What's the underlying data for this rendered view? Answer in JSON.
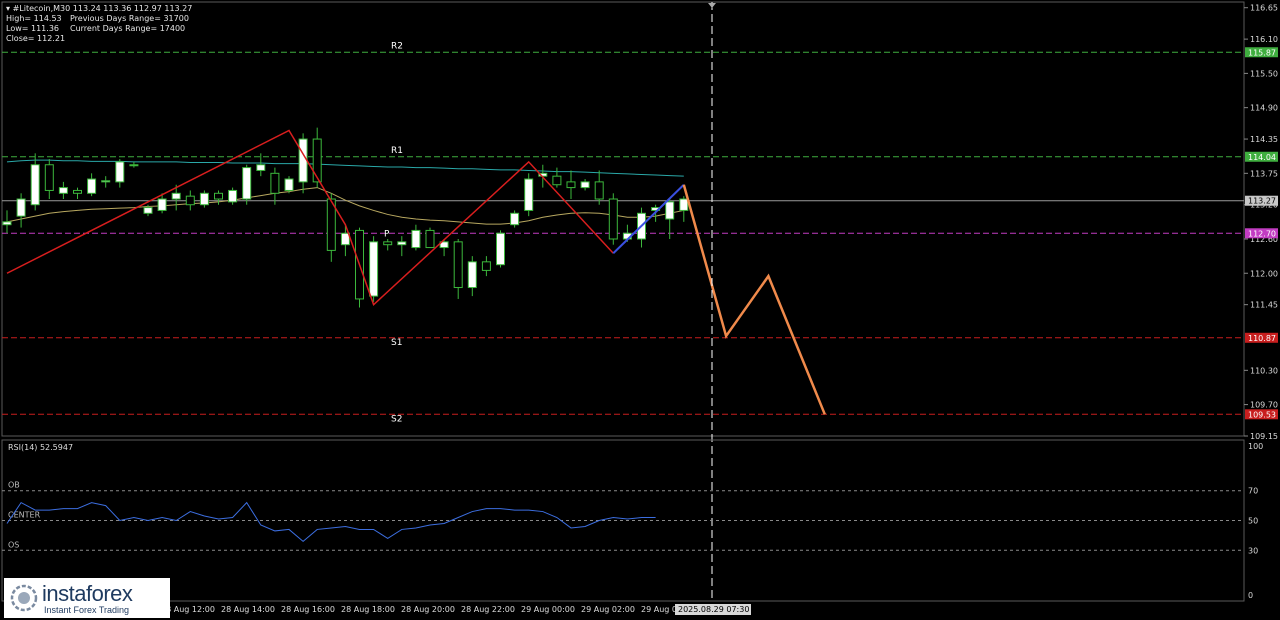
{
  "header": {
    "symbol_line": "#Litecoin,M30  113.24 113.36 112.97 113.27",
    "high": "High= 114.53",
    "prev_range": "Previous Days Range= 31700",
    "low": "Low= 111.36",
    "curr_range": "Current Days Range= 17400",
    "close": "Close= 112.21"
  },
  "chart_data": {
    "type": "candlestick",
    "price_axis": [
      "116.65",
      "116.10",
      "115.50",
      "114.90",
      "114.35",
      "113.75",
      "113.20",
      "112.60",
      "112.00",
      "111.45",
      "110.30",
      "109.70",
      "109.15"
    ],
    "price_range": [
      109.15,
      116.75
    ],
    "levels": [
      {
        "name": "R2",
        "price": 115.87,
        "label": "115.87",
        "color": "#3fae3f"
      },
      {
        "name": "R1",
        "price": 114.04,
        "label": "114.04",
        "color": "#3fae3f"
      },
      {
        "name": "P",
        "price": 112.7,
        "label": "112.70",
        "color": "#c23cc2"
      },
      {
        "name": "S1",
        "price": 110.87,
        "label": "110.87",
        "color": "#c81e1e"
      },
      {
        "name": "S2",
        "price": 109.53,
        "label": "109.53",
        "color": "#c81e1e"
      }
    ],
    "current_price": {
      "price": 113.27,
      "label": "113.27"
    },
    "candles": [
      {
        "o": 112.85,
        "h": 113.1,
        "l": 112.7,
        "c": 112.9
      },
      {
        "o": 113.0,
        "h": 113.4,
        "l": 112.8,
        "c": 113.3
      },
      {
        "o": 113.2,
        "h": 114.1,
        "l": 113.1,
        "c": 113.9
      },
      {
        "o": 113.9,
        "h": 114.0,
        "l": 113.3,
        "c": 113.45
      },
      {
        "o": 113.4,
        "h": 113.6,
        "l": 113.3,
        "c": 113.5
      },
      {
        "o": 113.45,
        "h": 113.5,
        "l": 113.3,
        "c": 113.4
      },
      {
        "o": 113.4,
        "h": 113.75,
        "l": 113.35,
        "c": 113.65
      },
      {
        "o": 113.6,
        "h": 113.7,
        "l": 113.5,
        "c": 113.62
      },
      {
        "o": 113.6,
        "h": 114.0,
        "l": 113.5,
        "c": 113.95
      },
      {
        "o": 113.9,
        "h": 113.95,
        "l": 113.85,
        "c": 113.9
      },
      {
        "o": 113.05,
        "h": 113.2,
        "l": 113.0,
        "c": 113.15
      },
      {
        "o": 113.1,
        "h": 113.4,
        "l": 113.05,
        "c": 113.3
      },
      {
        "o": 113.3,
        "h": 113.55,
        "l": 113.1,
        "c": 113.4
      },
      {
        "o": 113.35,
        "h": 113.45,
        "l": 113.1,
        "c": 113.2
      },
      {
        "o": 113.2,
        "h": 113.45,
        "l": 113.15,
        "c": 113.4
      },
      {
        "o": 113.4,
        "h": 113.45,
        "l": 113.2,
        "c": 113.3
      },
      {
        "o": 113.25,
        "h": 113.5,
        "l": 113.2,
        "c": 113.45
      },
      {
        "o": 113.3,
        "h": 113.9,
        "l": 113.2,
        "c": 113.85
      },
      {
        "o": 113.8,
        "h": 114.1,
        "l": 113.7,
        "c": 113.9
      },
      {
        "o": 113.75,
        "h": 113.85,
        "l": 113.2,
        "c": 113.4
      },
      {
        "o": 113.45,
        "h": 113.7,
        "l": 113.4,
        "c": 113.65
      },
      {
        "o": 113.6,
        "h": 114.45,
        "l": 113.4,
        "c": 114.35
      },
      {
        "o": 114.35,
        "h": 114.55,
        "l": 113.5,
        "c": 113.6
      },
      {
        "o": 113.3,
        "h": 113.4,
        "l": 112.2,
        "c": 112.4
      },
      {
        "o": 112.5,
        "h": 112.85,
        "l": 112.3,
        "c": 112.7
      },
      {
        "o": 112.75,
        "h": 112.8,
        "l": 111.4,
        "c": 111.55
      },
      {
        "o": 111.6,
        "h": 112.65,
        "l": 111.5,
        "c": 112.55
      },
      {
        "o": 112.55,
        "h": 112.6,
        "l": 112.4,
        "c": 112.5
      },
      {
        "o": 112.5,
        "h": 112.65,
        "l": 112.3,
        "c": 112.55
      },
      {
        "o": 112.45,
        "h": 112.85,
        "l": 112.4,
        "c": 112.75
      },
      {
        "o": 112.75,
        "h": 112.8,
        "l": 112.5,
        "c": 112.45
      },
      {
        "o": 112.45,
        "h": 112.6,
        "l": 112.3,
        "c": 112.55
      },
      {
        "o": 112.55,
        "h": 112.6,
        "l": 111.55,
        "c": 111.75
      },
      {
        "o": 111.75,
        "h": 112.3,
        "l": 111.6,
        "c": 112.2
      },
      {
        "o": 112.2,
        "h": 112.3,
        "l": 111.95,
        "c": 112.05
      },
      {
        "o": 112.15,
        "h": 112.75,
        "l": 112.1,
        "c": 112.7
      },
      {
        "o": 112.85,
        "h": 113.1,
        "l": 112.8,
        "c": 113.05
      },
      {
        "o": 113.1,
        "h": 113.75,
        "l": 113.0,
        "c": 113.65
      },
      {
        "o": 113.7,
        "h": 113.9,
        "l": 113.5,
        "c": 113.75
      },
      {
        "o": 113.7,
        "h": 113.85,
        "l": 113.5,
        "c": 113.55
      },
      {
        "o": 113.6,
        "h": 113.8,
        "l": 113.3,
        "c": 113.5
      },
      {
        "o": 113.5,
        "h": 113.65,
        "l": 113.45,
        "c": 113.6
      },
      {
        "o": 113.6,
        "h": 113.8,
        "l": 113.2,
        "c": 113.3
      },
      {
        "o": 113.3,
        "h": 113.4,
        "l": 112.5,
        "c": 112.6
      },
      {
        "o": 112.6,
        "h": 112.85,
        "l": 112.55,
        "c": 112.7
      },
      {
        "o": 112.6,
        "h": 113.15,
        "l": 112.45,
        "c": 113.05
      },
      {
        "o": 113.1,
        "h": 113.2,
        "l": 112.9,
        "c": 113.15
      },
      {
        "o": 112.95,
        "h": 113.3,
        "l": 112.6,
        "c": 113.25
      },
      {
        "o": 113.1,
        "h": 113.35,
        "l": 112.9,
        "c": 113.3
      }
    ],
    "ma_long": [
      113.95,
      113.97,
      113.98,
      113.98,
      113.97,
      113.97,
      113.96,
      113.96,
      113.96,
      113.95,
      113.95,
      113.95,
      113.95,
      113.94,
      113.94,
      113.94,
      113.93,
      113.93,
      113.93,
      113.92,
      113.92,
      113.92,
      113.91,
      113.9,
      113.89,
      113.88,
      113.87,
      113.86,
      113.86,
      113.85,
      113.85,
      113.84,
      113.83,
      113.83,
      113.82,
      113.81,
      113.81,
      113.8,
      113.79,
      113.78,
      113.78,
      113.77,
      113.76,
      113.75,
      113.74,
      113.73,
      113.72,
      113.71,
      113.7
    ],
    "ma_short": [
      112.9,
      112.95,
      113.0,
      113.05,
      113.08,
      113.1,
      113.12,
      113.13,
      113.14,
      113.15,
      113.17,
      113.18,
      113.2,
      113.22,
      113.23,
      113.25,
      113.28,
      113.32,
      113.36,
      113.4,
      113.43,
      113.47,
      113.5,
      113.4,
      113.28,
      113.18,
      113.1,
      113.03,
      112.98,
      112.95,
      112.93,
      112.92,
      112.9,
      112.88,
      112.86,
      112.86,
      112.88,
      112.92,
      112.98,
      113.02,
      113.05,
      113.06,
      113.05,
      113.02,
      112.98,
      112.98,
      113.0,
      113.05,
      113.1
    ],
    "zigzag_red": [
      [
        0,
        112.0
      ],
      [
        20,
        114.5
      ],
      [
        24,
        112.85
      ],
      [
        26,
        111.45
      ],
      [
        37,
        113.95
      ],
      [
        43,
        112.35
      ]
    ],
    "zigzag_blue": [
      [
        43,
        112.35
      ],
      [
        48,
        113.55
      ]
    ],
    "projection": [
      [
        48,
        113.55
      ],
      [
        51,
        110.9
      ],
      [
        54,
        111.95
      ],
      [
        58,
        109.53
      ]
    ],
    "time_labels": [
      "28 Aug 12:00",
      "28 Aug 14:00",
      "28 Aug 16:00",
      "28 Aug 18:00",
      "28 Aug 20:00",
      "28 Aug 22:00",
      "29 Aug 00:00",
      "29 Aug 02:00",
      "29 Aug 04:00",
      "29"
    ],
    "cursor_time": "2025.08.29 07:30",
    "rsi": {
      "label": "RSI(14) 52.5947",
      "levels": [
        {
          "name": "OB",
          "value": 70
        },
        {
          "name": "CENTER",
          "value": 50
        },
        {
          "name": "OS",
          "value": 30
        }
      ],
      "axis": [
        "100",
        "70",
        "50",
        "30",
        "0"
      ],
      "values": [
        48,
        62,
        57,
        57,
        58,
        58,
        62,
        60,
        50,
        52,
        50,
        52,
        50,
        56,
        53,
        51,
        52,
        62,
        47,
        43,
        44,
        36,
        44,
        45,
        46,
        44,
        44,
        38,
        44,
        45,
        47,
        48,
        52,
        56,
        58,
        58,
        57,
        57,
        56,
        52,
        45,
        46,
        50,
        52,
        51,
        52,
        52
      ]
    }
  },
  "logo": {
    "brand": "instaforex",
    "tagline": "Instant Forex Trading"
  },
  "colors": {
    "candle_up": "#ffffff",
    "candle_down": "#000000",
    "wick": "#3cb83c",
    "ma_long": "#2aa8a8",
    "ma_short": "#b8a860",
    "zigzag_red": "#d81e1e",
    "zigzag_blue": "#3a50e0",
    "projection": "#f08a4b",
    "rsi_line": "#3c6ee0"
  }
}
